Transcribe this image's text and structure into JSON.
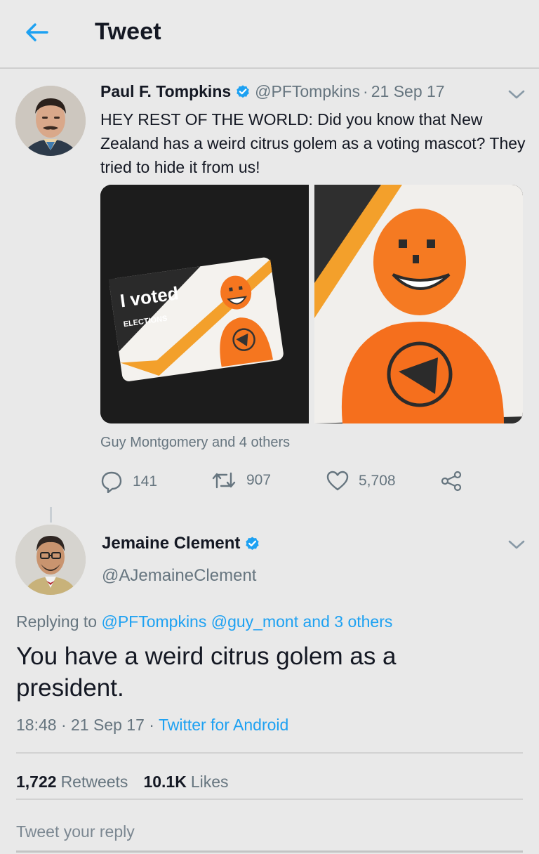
{
  "header": {
    "title": "Tweet",
    "back_icon": "arrow-left-icon",
    "accent_color": "#1da1f2"
  },
  "tweet1": {
    "name": "Paul F. Tompkins",
    "handle": "@PFTompkins",
    "separator": "·",
    "date": "21 Sep 17",
    "text": "HEY REST OF THE WORLD: Did you know that New Zealand has a weird citrus golem as a voting mascot? They tried to hide it from us!",
    "media": {
      "sticker_text": "I voted",
      "sticker_subtext": "ELECTIONS"
    },
    "liked_by": "Guy Montgomery and 4 others",
    "actions": {
      "replies": "141",
      "retweets": "907",
      "likes": "5,708"
    }
  },
  "tweet2": {
    "name": "Jemaine Clement",
    "handle": "@AJemaineClement",
    "replying_prefix": "Replying to",
    "replying_to_1": "@PFTompkins",
    "replying_to_2": "@guy_mont",
    "replying_others": "and 3 others",
    "text": "You have a weird citrus golem as a president.",
    "time": "18:48",
    "separator": "·",
    "date": "21 Sep 17",
    "source": "Twitter for Android",
    "retweets_count": "1,722",
    "retweets_label": "Retweets",
    "likes_count": "10.1K",
    "likes_label": "Likes"
  },
  "reply": {
    "placeholder": "Tweet your reply"
  }
}
